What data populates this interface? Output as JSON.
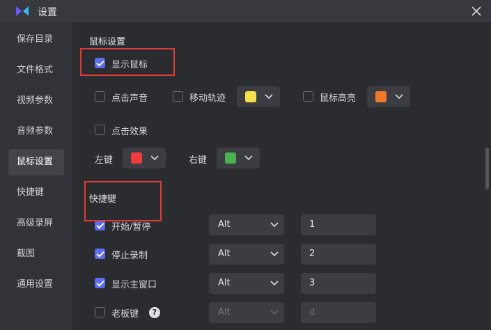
{
  "window": {
    "title": "设置"
  },
  "sidebar": {
    "items": [
      {
        "label": "保存目录"
      },
      {
        "label": "文件格式"
      },
      {
        "label": "视频参数"
      },
      {
        "label": "音频参数"
      },
      {
        "label": "鼠标设置",
        "active": true
      },
      {
        "label": "快捷键"
      },
      {
        "label": "高级录屏"
      },
      {
        "label": "截图"
      },
      {
        "label": "通用设置"
      }
    ]
  },
  "mouse": {
    "title": "鼠标设置",
    "show_cursor": {
      "label": "显示鼠标",
      "checked": true
    },
    "click_sound": {
      "label": "点击声音",
      "checked": false
    },
    "move_trail": {
      "label": "移动轨迹",
      "checked": false,
      "color": "#f5e04a"
    },
    "highlight": {
      "label": "鼠标高亮",
      "checked": false,
      "color": "#f07a2a"
    },
    "click_effect": {
      "label": "点击效果",
      "checked": false
    },
    "left_key": {
      "label": "左键",
      "color": "#ef3b3b"
    },
    "right_key": {
      "label": "右键",
      "color": "#4caf50"
    }
  },
  "hotkeys": {
    "title": "快捷键",
    "rows": [
      {
        "label": "开始/暂停",
        "checked": true,
        "modifier": "Alt",
        "key": "1",
        "disabled": false
      },
      {
        "label": "停止录制",
        "checked": true,
        "modifier": "Alt",
        "key": "2",
        "disabled": false
      },
      {
        "label": "显示主窗口",
        "checked": true,
        "modifier": "Alt",
        "key": "3",
        "disabled": false
      },
      {
        "label": "老板键",
        "checked": false,
        "modifier": "Alt",
        "key": "d",
        "disabled": true
      }
    ],
    "help": "?"
  },
  "colors": {
    "accent": "#5b6cf0",
    "highlight_box": "#e03a3a"
  },
  "icons": {
    "app": "app-logo-icon",
    "close": "close-icon",
    "dropdown": "chevron-down-icon",
    "help": "question-icon"
  }
}
